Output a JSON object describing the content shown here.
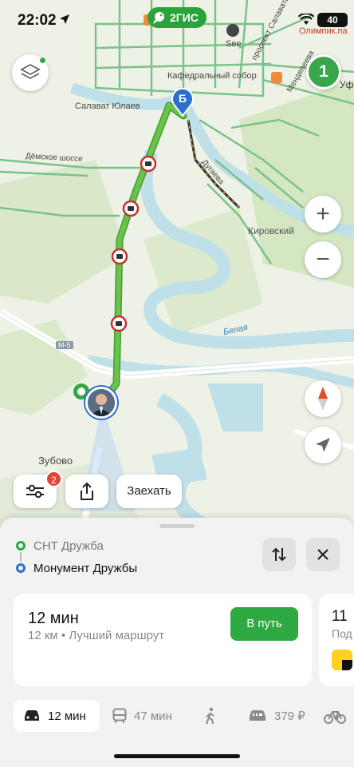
{
  "status_bar": {
    "time": "22:02",
    "battery": "40",
    "top_right_label": "Олимпик.па"
  },
  "brand": {
    "name": "2ГИС"
  },
  "map": {
    "labels": {
      "cathedral": "Кафедральный собор",
      "monument": "Салават Юлаев",
      "see": "See",
      "road_dema": "Дёмское шоссе",
      "street_dugaeva": "Дугаева",
      "district_kirovsky": "Кировский",
      "river": "Белая",
      "highway": "М-5",
      "avenue_salavata": "проспект Салавата",
      "street_mendeleeva": "Менделеева",
      "town_zubovo": "Зубово",
      "edge_uf": "Уф"
    },
    "destination_marker": "Б",
    "traffic_level": "1",
    "zoom_in": "+",
    "zoom_out": "−"
  },
  "toolbar": {
    "filter_badge": "2",
    "stopover_label": "Заехать"
  },
  "route": {
    "from": "СНТ Дружба",
    "to": "Монумент Дружбы",
    "main_card": {
      "duration": "12 мин",
      "summary": "12 км • Лучший маршрут",
      "go_label": "В путь"
    },
    "second_card": {
      "duration": "11",
      "summary": "Под"
    }
  },
  "modes": [
    {
      "icon": "car-icon",
      "label": "12 мин",
      "active": true
    },
    {
      "icon": "bus-icon",
      "label": "47 мин",
      "active": false
    },
    {
      "icon": "walk-icon",
      "label": "",
      "active": false
    },
    {
      "icon": "taxi-icon",
      "label": "379 ₽",
      "active": false
    },
    {
      "icon": "bike-icon",
      "label": "",
      "active": false
    }
  ],
  "colors": {
    "accent": "#2ea842",
    "route": "#6cc24a",
    "destination": "#2d6fd1",
    "badge": "#e2443a"
  }
}
